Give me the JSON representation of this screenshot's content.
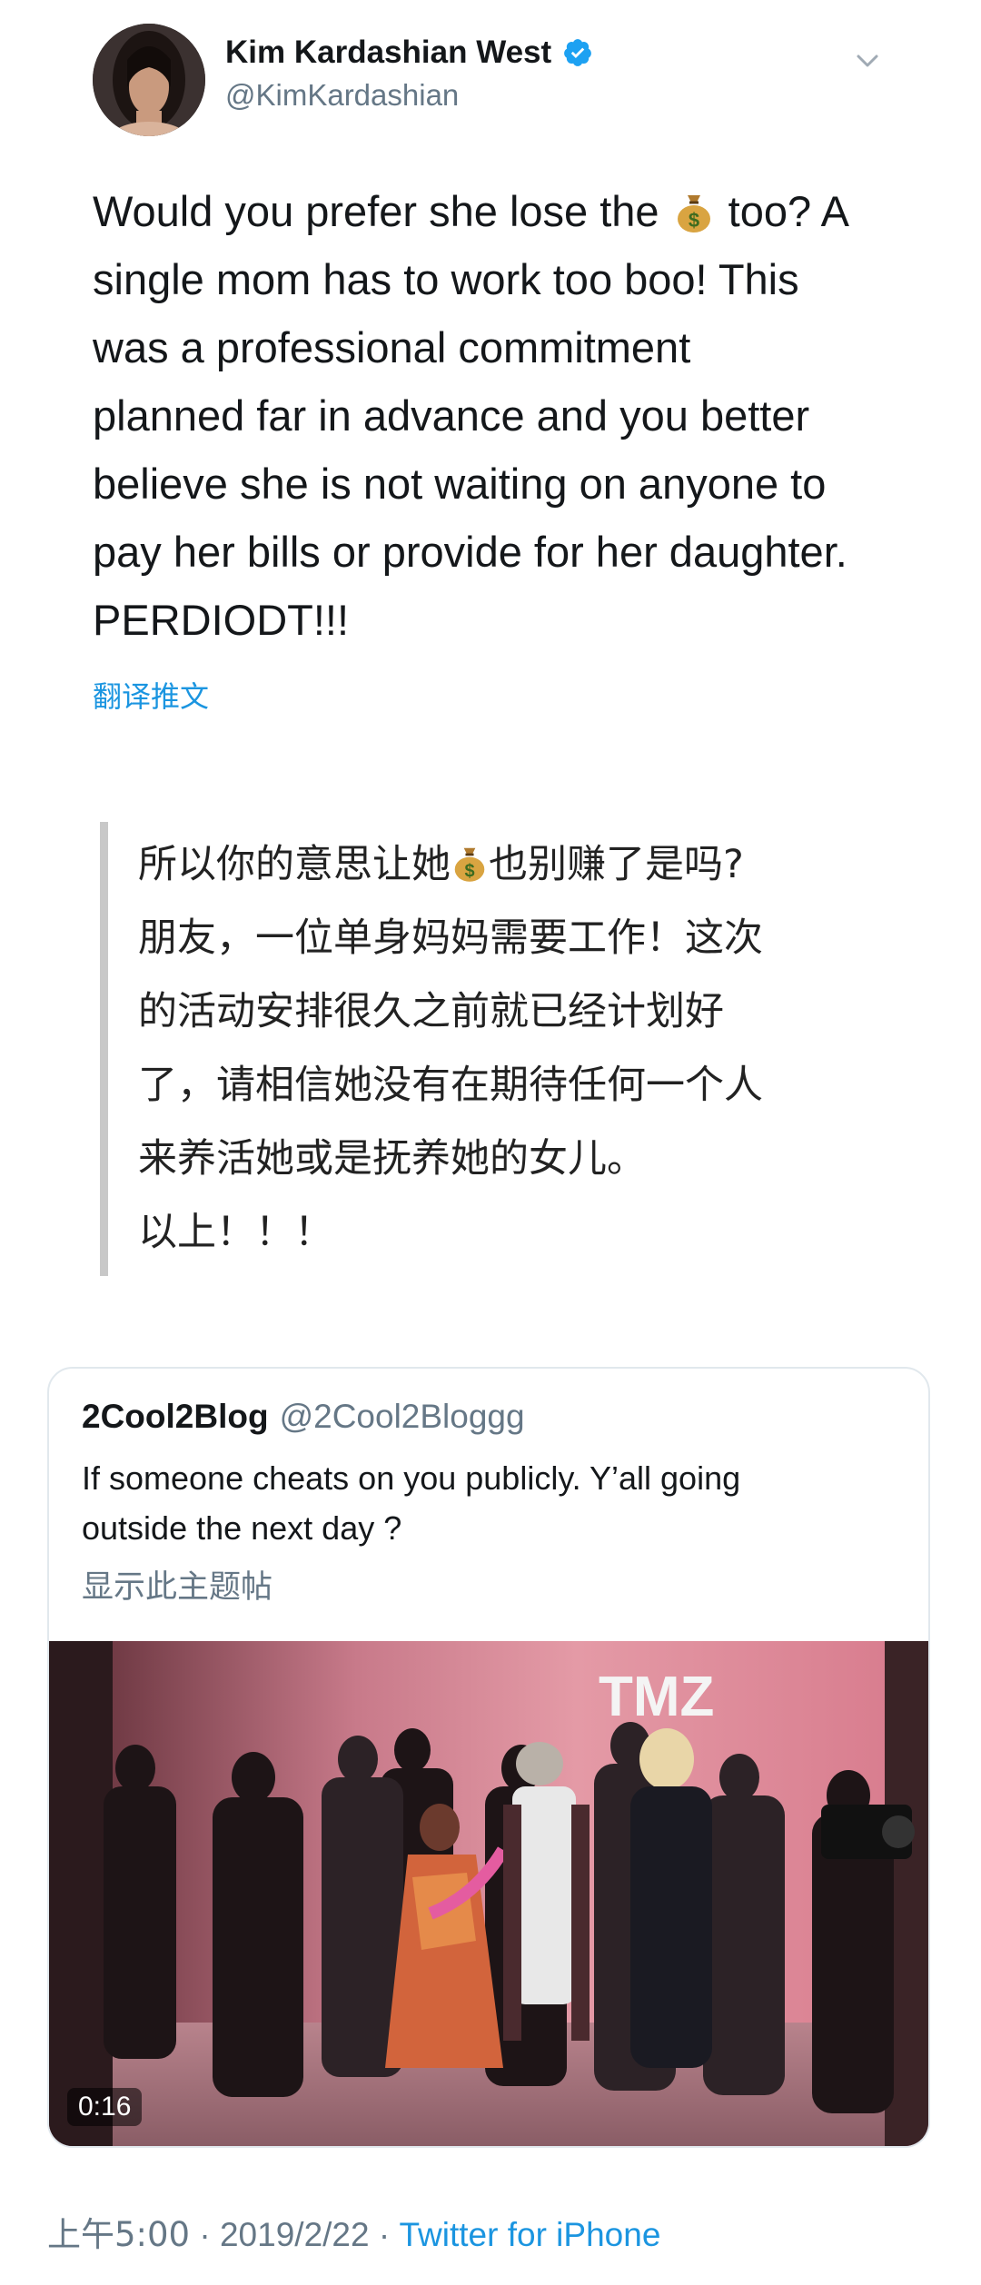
{
  "author": {
    "display_name": "Kim Kardashian West",
    "handle": "@KimKardashian",
    "verified": true
  },
  "tweet": {
    "lines": [
      [
        "Would you prefer she lose the ",
        " too? A"
      ],
      "single mom has to work too boo! This",
      "was a professional commitment",
      "planned far in advance and you better",
      "believe she is not waiting on anyone to",
      "pay her bills or provide for her daughter.",
      "PERDIODT!!!"
    ],
    "translate_label": "翻译推文"
  },
  "translation": {
    "lines": [
      [
        "所以你的意思让她",
        "也别赚了是吗?"
      ],
      "朋友，一位单身妈妈需要工作！这次",
      "的活动安排很久之前就已经计划好",
      "了，请相信她没有在期待任何一个人",
      "来养活她或是抚养她的女儿。",
      "以上！！！"
    ]
  },
  "quoted": {
    "name": "2Cool2Blog",
    "handle": "@2Cool2Bloggg",
    "text_lines": [
      "If someone cheats on you publicly. Y’all going",
      "outside the next day ?"
    ],
    "thread_label": "显示此主题帖",
    "video": {
      "watermark": "TMZ",
      "duration": "0:16"
    }
  },
  "footer": {
    "time": "上午5:00",
    "separator": "·",
    "date": "2019/2/22",
    "source": "Twitter for iPhone"
  },
  "colors": {
    "link": "#1b95e0",
    "secondary_text": "#657786",
    "verified_badge": "#1da1f2"
  },
  "icons": [
    "verified-badge-icon",
    "chevron-down-icon",
    "money-bag-icon"
  ]
}
